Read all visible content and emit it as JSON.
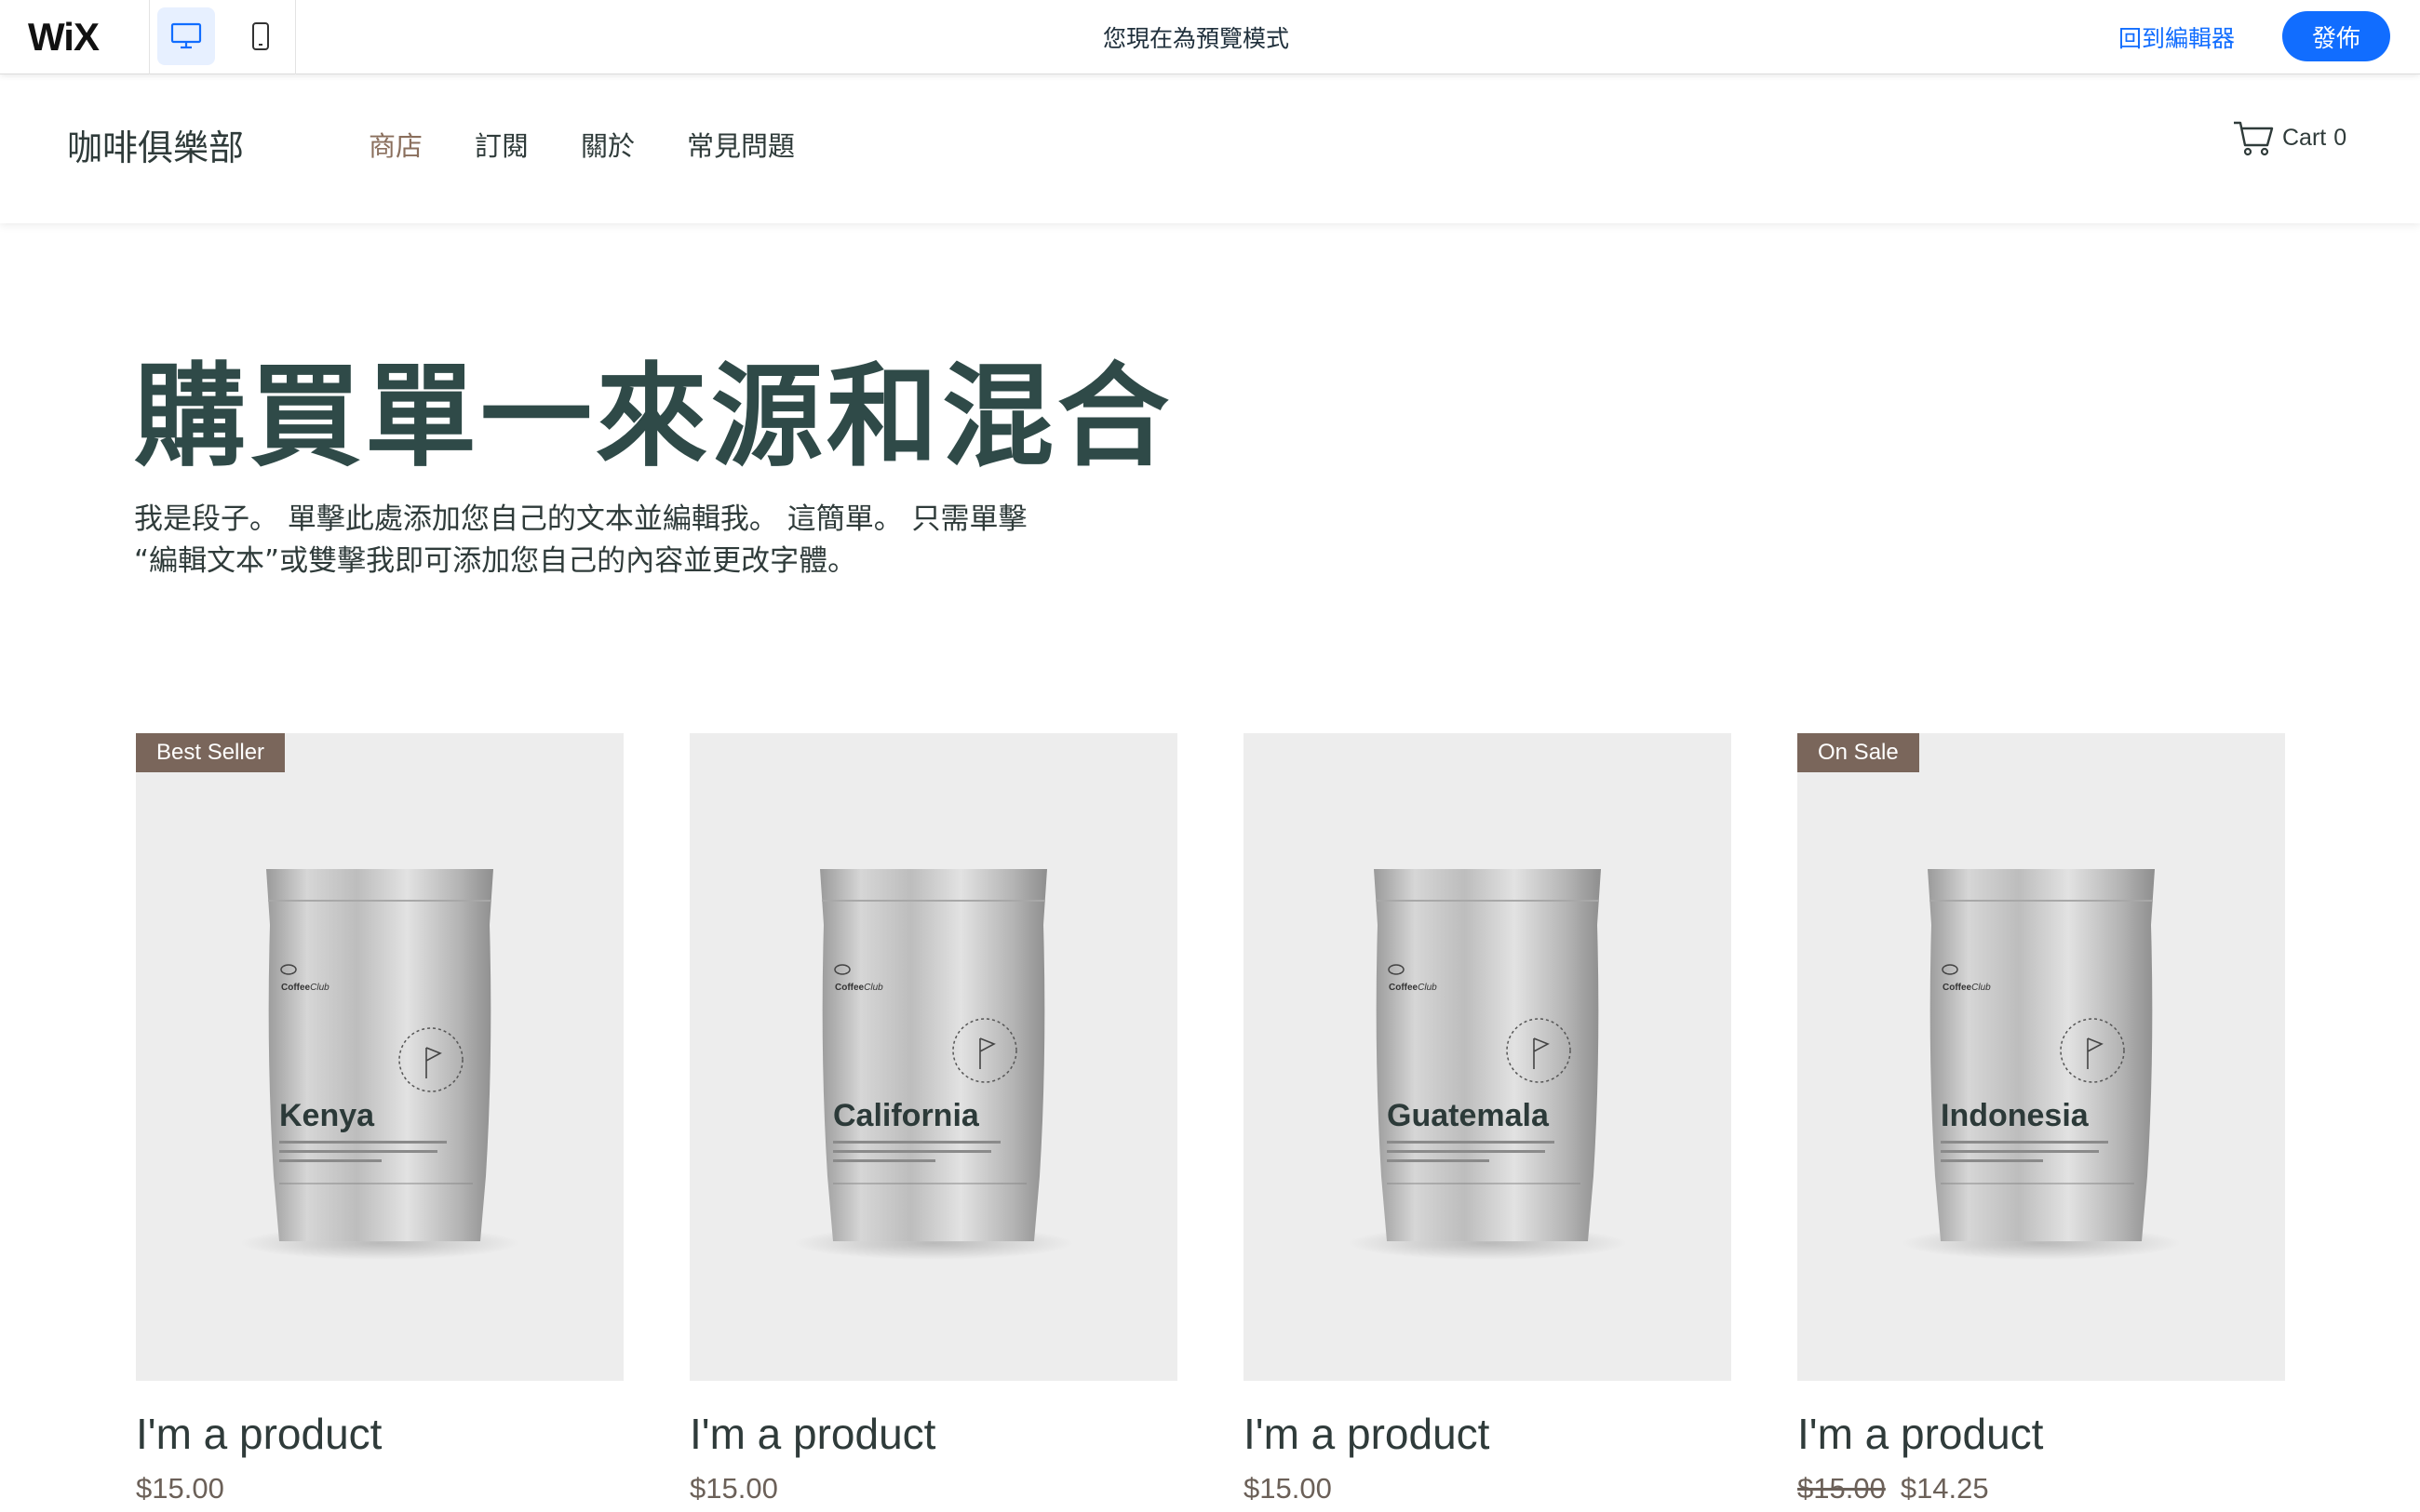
{
  "wix_bar": {
    "logo": "WiX",
    "preview_message": "您現在為預覽模式",
    "back_to_editor": "回到編輯器",
    "publish": "發佈",
    "accent_color": "#116dff"
  },
  "header": {
    "brand": "咖啡俱樂部",
    "nav": [
      {
        "label": "商店",
        "active": true
      },
      {
        "label": "訂閱",
        "active": false
      },
      {
        "label": "關於",
        "active": false
      },
      {
        "label": "常見問題",
        "active": false
      }
    ],
    "cart_label": "Cart",
    "cart_count": "0"
  },
  "hero": {
    "title": "購買單一來源和混合",
    "paragraph_line1": "我是段子。 單擊此處添加您自己的文本並編輯我。 這簡單。 只需單擊",
    "paragraph_line2": "“編輯文本”或雙擊我即可添加您自己的內容並更改字體。"
  },
  "products": [
    {
      "ribbon": "Best Seller",
      "bag_label": "Kenya",
      "name": "I'm a product",
      "price": "$15.00",
      "sale_price": ""
    },
    {
      "ribbon": "",
      "bag_label": "California",
      "name": "I'm a product",
      "price": "$15.00",
      "sale_price": ""
    },
    {
      "ribbon": "",
      "bag_label": "Guatemala",
      "name": "I'm a product",
      "price": "$15.00",
      "sale_price": ""
    },
    {
      "ribbon": "On Sale",
      "bag_label": "Indonesia",
      "name": "I'm a product",
      "price": "$15.00",
      "sale_price": "$14.25"
    }
  ]
}
